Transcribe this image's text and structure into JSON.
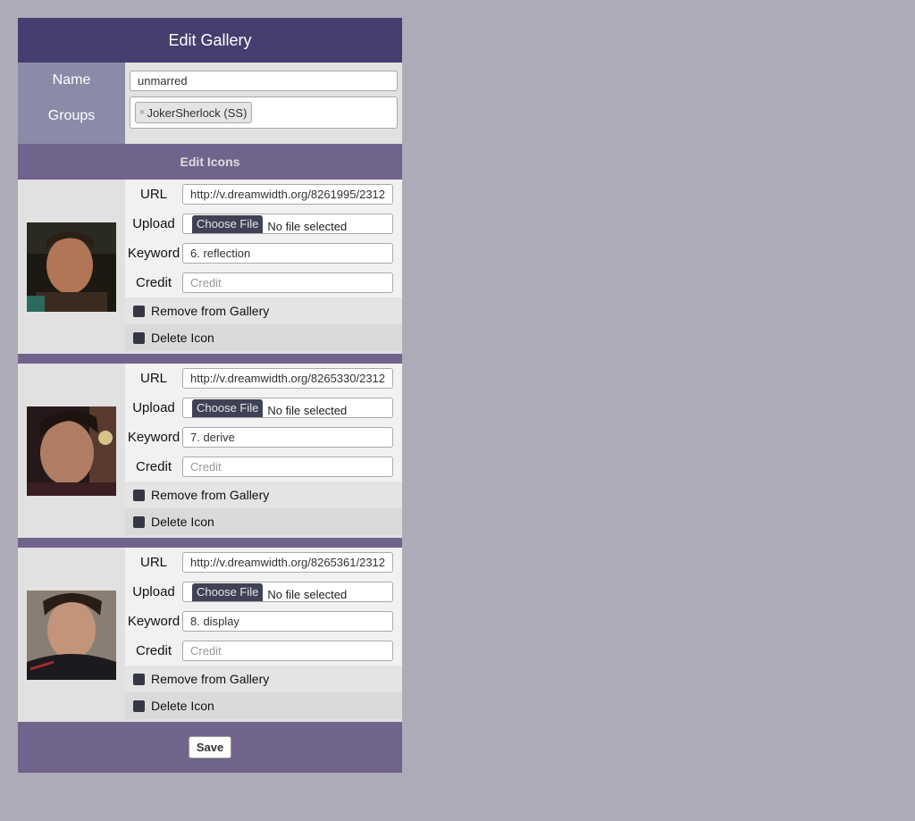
{
  "header": {
    "title": "Edit Gallery"
  },
  "gallery": {
    "name_label": "Name",
    "name_value": "unmarred",
    "groups_label": "Groups",
    "group_tags": [
      {
        "remove": "×",
        "label": "JokerSherlock (SS)"
      }
    ]
  },
  "icons_section": {
    "title": "Edit Icons"
  },
  "field_labels": {
    "url": "URL",
    "upload": "Upload",
    "keyword": "Keyword",
    "credit": "Credit"
  },
  "upload": {
    "button_label": "Choose File",
    "status": "No file selected"
  },
  "icons": [
    {
      "url": "http://v.dreamwidth.org/8261995/2312",
      "keyword": "6. reflection",
      "credit_placeholder": "Credit",
      "remove_label": "Remove from Gallery",
      "delete_label": "Delete Icon"
    },
    {
      "url": "http://v.dreamwidth.org/8265330/2312",
      "keyword": "7. derive",
      "credit_placeholder": "Credit",
      "remove_label": "Remove from Gallery",
      "delete_label": "Delete Icon"
    },
    {
      "url": "http://v.dreamwidth.org/8265361/2312",
      "keyword": "8. display",
      "credit_placeholder": "Credit",
      "remove_label": "Remove from Gallery",
      "delete_label": "Delete Icon"
    }
  ],
  "footer": {
    "save_label": "Save"
  },
  "colors": {
    "background": "#aeabb8",
    "title_bar": "#443f6e",
    "section_bar": "#71648c",
    "label_column": "#8b8aa8"
  }
}
